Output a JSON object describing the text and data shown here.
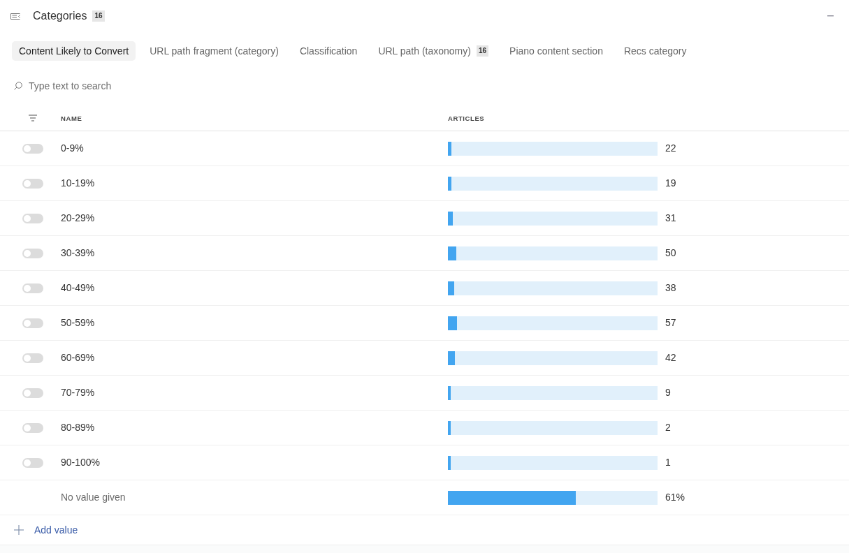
{
  "panel": {
    "title": "Categories",
    "count": "16"
  },
  "tabs": [
    {
      "label": "Content Likely to Convert",
      "selected": true
    },
    {
      "label": "URL path fragment (category)",
      "selected": false
    },
    {
      "label": "Classification",
      "selected": false
    },
    {
      "label": "URL path (taxonomy)",
      "count": "16",
      "selected": false
    },
    {
      "label": "Piano content section",
      "selected": false
    },
    {
      "label": "Recs category",
      "selected": false
    }
  ],
  "search": {
    "placeholder": "Type text to search"
  },
  "table": {
    "columns": [
      "NAME",
      "ARTICLES"
    ],
    "rows": [
      {
        "kind": "value",
        "name": "0-9%",
        "on": false,
        "level": 0.017,
        "count": "22"
      },
      {
        "kind": "value",
        "name": "10-19%",
        "on": false,
        "level": 0.015,
        "count": "19"
      },
      {
        "kind": "value",
        "name": "20-29%",
        "on": false,
        "level": 0.023,
        "count": "31"
      },
      {
        "kind": "value",
        "name": "30-39%",
        "on": false,
        "level": 0.04,
        "count": "50"
      },
      {
        "kind": "value",
        "name": "40-49%",
        "on": false,
        "level": 0.03,
        "count": "38"
      },
      {
        "kind": "value",
        "name": "50-59%",
        "on": false,
        "level": 0.043,
        "count": "57"
      },
      {
        "kind": "value",
        "name": "60-69%",
        "on": false,
        "level": 0.033,
        "count": "42"
      },
      {
        "kind": "value",
        "name": "70-79%",
        "on": false,
        "level": 0.013,
        "count": "9"
      },
      {
        "kind": "value",
        "name": "80-89%",
        "on": false,
        "level": 0.013,
        "count": "2"
      },
      {
        "kind": "value",
        "name": "90-100%",
        "on": false,
        "level": 0.013,
        "count": "1"
      },
      {
        "kind": "empty",
        "name": "No value given",
        "level": 0.61,
        "count": "61%"
      }
    ]
  },
  "add_button": {
    "label": "Add value"
  }
}
